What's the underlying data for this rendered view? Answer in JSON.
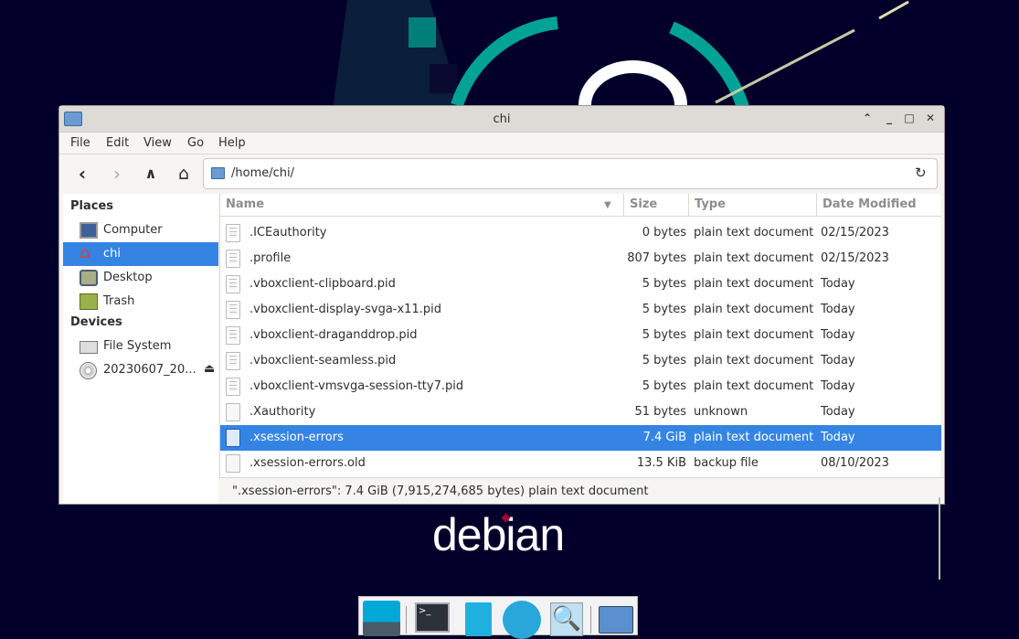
{
  "window": {
    "title": "chi"
  },
  "menu": [
    "File",
    "Edit",
    "View",
    "Go",
    "Help"
  ],
  "address": {
    "path": "/home/chi/"
  },
  "sidebar": {
    "places_heading": "Places",
    "places": [
      "Computer",
      "chi",
      "Desktop",
      "Trash"
    ],
    "devices_heading": "Devices",
    "devices": [
      "File System",
      "20230607_20..."
    ]
  },
  "columns": {
    "name": "Name",
    "size": "Size",
    "type": "Type",
    "date": "Date Modified"
  },
  "files": [
    {
      "name": ".ICEauthority",
      "size": "0 bytes",
      "type": "plain text document",
      "date": "02/15/2023",
      "icon": "text"
    },
    {
      "name": ".profile",
      "size": "807 bytes",
      "type": "plain text document",
      "date": "02/15/2023",
      "icon": "text"
    },
    {
      "name": ".vboxclient-clipboard.pid",
      "size": "5 bytes",
      "type": "plain text document",
      "date": "Today",
      "icon": "text"
    },
    {
      "name": ".vboxclient-display-svga-x11.pid",
      "size": "5 bytes",
      "type": "plain text document",
      "date": "Today",
      "icon": "text"
    },
    {
      "name": ".vboxclient-draganddrop.pid",
      "size": "5 bytes",
      "type": "plain text document",
      "date": "Today",
      "icon": "text"
    },
    {
      "name": ".vboxclient-seamless.pid",
      "size": "5 bytes",
      "type": "plain text document",
      "date": "Today",
      "icon": "text"
    },
    {
      "name": ".vboxclient-vmsvga-session-tty7.pid",
      "size": "5 bytes",
      "type": "plain text document",
      "date": "Today",
      "icon": "text"
    },
    {
      "name": ".Xauthority",
      "size": "51 bytes",
      "type": "unknown",
      "date": "Today",
      "icon": "blank"
    },
    {
      "name": ".xsession-errors",
      "size": "7.4 GiB",
      "type": "plain text document",
      "date": "Today",
      "icon": "text",
      "selected": true
    },
    {
      "name": ".xsession-errors.old",
      "size": "13.5 KiB",
      "type": "backup file",
      "date": "08/10/2023",
      "icon": "blank"
    }
  ],
  "status": "\".xsession-errors\": 7.4 GiB (7,915,274,685 bytes) plain text document",
  "desktop": {
    "logo": "debian"
  },
  "colors": {
    "accent": "#3584e4",
    "background": "#02002a",
    "teal": "#00a396"
  }
}
